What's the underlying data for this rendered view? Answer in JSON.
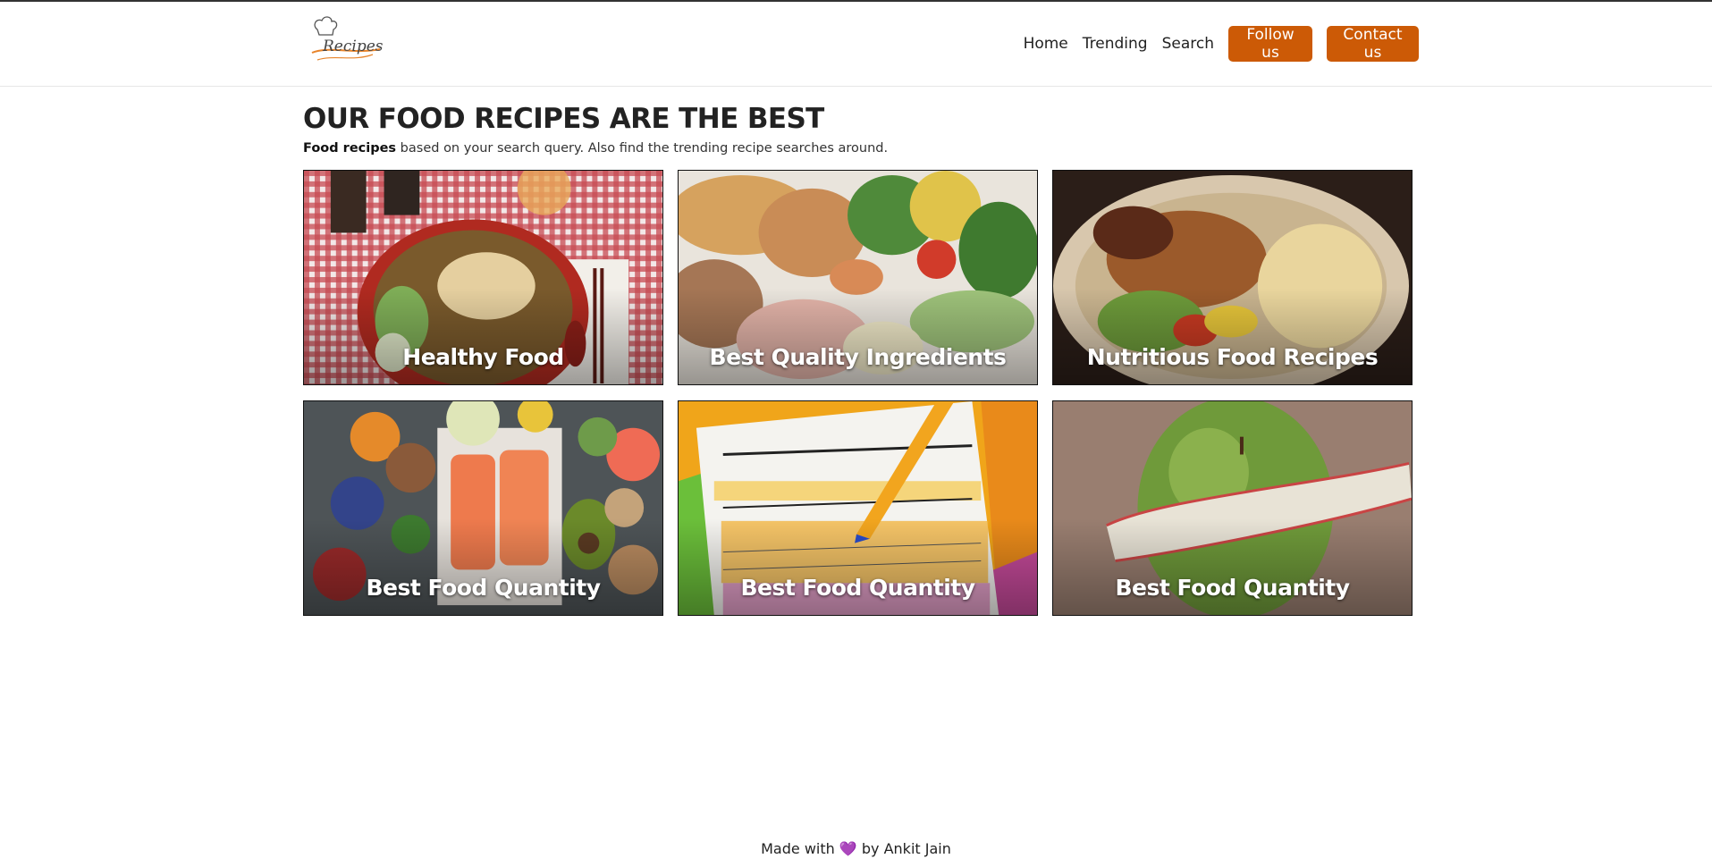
{
  "header": {
    "logo_text": "Recipes",
    "nav": [
      {
        "label": "Home"
      },
      {
        "label": "Trending"
      },
      {
        "label": "Search"
      }
    ],
    "follow_label": "Follow us",
    "contact_label": "Contact us"
  },
  "hero": {
    "title": "OUR FOOD RECIPES ARE THE BEST",
    "subtitle_bold": "Food recipes",
    "subtitle_rest": " based on your search query. Also find the trending recipe searches around."
  },
  "cards": [
    {
      "label": "Healthy Food"
    },
    {
      "label": "Best Quality Ingredients"
    },
    {
      "label": "Nutritious Food Recipes"
    },
    {
      "label": "Best Food Quantity"
    },
    {
      "label": "Best Food Quantity"
    },
    {
      "label": "Best Food Quantity"
    }
  ],
  "footer": {
    "prefix": "Made with",
    "heart": "💜",
    "suffix": "by Ankit Jain"
  },
  "colors": {
    "accent": "#cc5a06"
  }
}
